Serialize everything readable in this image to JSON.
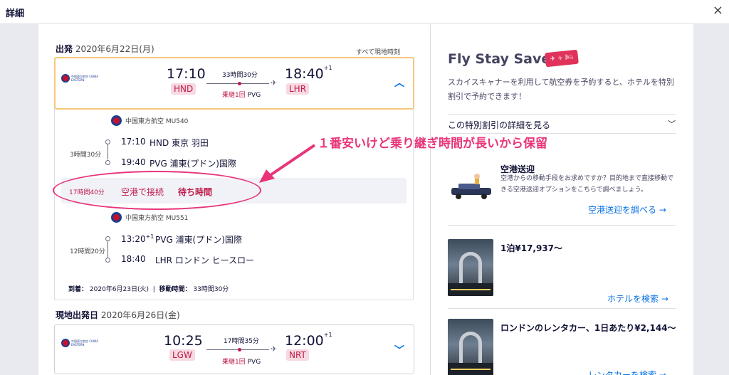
{
  "window": {
    "title": "詳細",
    "close_glyph": "×"
  },
  "outbound": {
    "label": "出発",
    "date": "2020年6月22日(月)",
    "tz_note": "すべて現地時刻",
    "airline_name": "中国東方航空 CHINA EASTERN",
    "dep_time": "17:10",
    "dep_code": "HND",
    "arr_time": "18:40",
    "arr_plus": "+1",
    "arr_code": "LHR",
    "duration": "33時間30分",
    "stops_label": "乗継1回",
    "stop_code": "PVG"
  },
  "segments": [
    {
      "carrier": "中国東方航空 MU540",
      "duration": "3時間30分",
      "dep_time": "17:10",
      "dep_place": "HND 東京 羽田",
      "arr_time": "19:40",
      "arr_place": "PVG 浦東(プドン)国際"
    },
    {
      "carrier": "中国東方航空 MU551",
      "duration": "12時間20分",
      "dep_time": "13:20",
      "dep_plus": "+1",
      "dep_place": "PVG 浦東(プドン)国際",
      "arr_time": "18:40",
      "arr_place": "LHR ロンドン ヒースロー"
    }
  ],
  "layover": {
    "duration": "17時間40分",
    "text": "空港で接続",
    "wait": "待ち時間"
  },
  "arrival_summary": {
    "arrive_label": "到着：",
    "arrive_date": "2020年6月23日(火)",
    "sep": "|",
    "travel_label": "移動時間：",
    "travel_time": "33時間30分"
  },
  "return": {
    "label": "現地出発日",
    "date": "2020年6月26日(金)",
    "airline_name": "中国東方航空 CHINA EASTERN",
    "dep_time": "10:25",
    "dep_code": "LGW",
    "arr_time": "12:00",
    "arr_plus": "+1",
    "arr_code": "NRT",
    "duration": "17時間35分",
    "stops_label": "乗継1回",
    "stop_code": "PVG"
  },
  "annotation": "１番安いけど乗り継ぎ時間が長いから保留",
  "fly_stay_save": {
    "title": "Fly Stay Save",
    "badge": "✈ + 🛏",
    "desc": "スカイスキャナーを利用して航空券を予約すると、ホテルを特別割引で予約できます！",
    "more": "この特別割引の詳細を見る"
  },
  "airport_transfer": {
    "title": "空港送迎",
    "text": "空港からの移動手段をお求めですか？目的地まで直接移動できる空港送迎オプションをこちらで調べましょう。",
    "link": "空港送迎を調べる →"
  },
  "hotel": {
    "title": "1泊¥17,937〜",
    "link": "ホテルを検索 →"
  },
  "car_rental": {
    "title": "ロンドンのレンタカー、1日あたり¥2,144〜",
    "link": "レンタカーを検索 →"
  }
}
